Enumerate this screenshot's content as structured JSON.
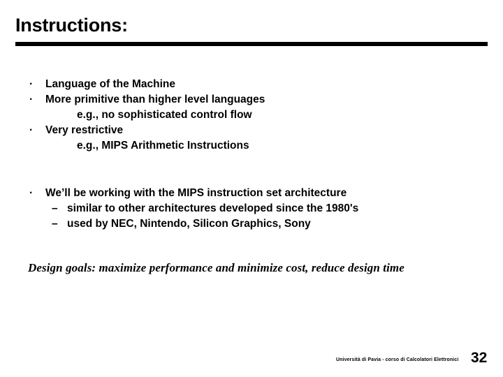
{
  "slide": {
    "title": "Instructions:",
    "body_lines": [
      {
        "type": "bullet",
        "marker": "·",
        "text": "Language of the Machine"
      },
      {
        "type": "bullet",
        "marker": "·",
        "text": "More primitive than higher level languages"
      },
      {
        "type": "cont",
        "marker": "",
        "text": "e.g., no sophisticated control flow"
      },
      {
        "type": "bullet",
        "marker": "·",
        "text": "Very restrictive"
      },
      {
        "type": "cont",
        "marker": "",
        "text": "e.g., MIPS Arithmetic Instructions"
      },
      {
        "type": "spacer",
        "marker": "",
        "text": ""
      },
      {
        "type": "bullet",
        "marker": "·",
        "text": "We’ll be working with the MIPS instruction set architecture"
      },
      {
        "type": "dash",
        "marker": "–",
        "text": "similar to other architectures developed since the 1980's"
      },
      {
        "type": "dash",
        "marker": "–",
        "text": "used by NEC, Nintendo, Silicon Graphics, Sony"
      }
    ],
    "design_goals": "Design goals:  maximize performance and minimize cost,  reduce design time",
    "footer_credit": "Università di Pavia  - corso di Calcolatori Elettronici",
    "page_number": "32",
    "colors": {
      "text": "#000000",
      "background": "#ffffff",
      "rule": "#000000"
    }
  }
}
